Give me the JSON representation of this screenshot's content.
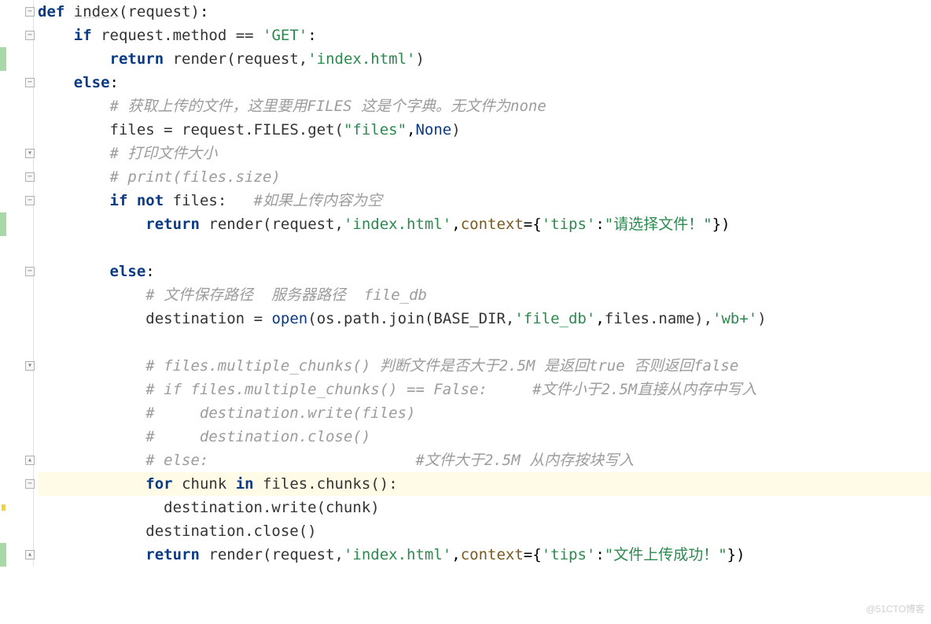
{
  "watermark": "@51CTO博客",
  "gutter": {
    "fold_minus": "−",
    "fold_open_down": "▾",
    "fold_open_up": "▴"
  },
  "code": {
    "l1": {
      "def": "def",
      "sp": " ",
      "fn": "index",
      "lp": "(",
      "arg": "request",
      "rp": ")",
      "colon": ":"
    },
    "l2": {
      "if": "if",
      "sp": " ",
      "expr": "request.method ",
      "eq": "==",
      "sp2": " ",
      "s": "'GET'",
      "colon": ":"
    },
    "l3": {
      "ret": "return",
      "sp": " ",
      "call": "render(request,",
      "s": "'index.html'",
      "rp": ")"
    },
    "l4": {
      "else": "else",
      "colon": ":"
    },
    "l5": {
      "c": "# 获取上传的文件，这里要用FILES 这是个字典。无文件为none"
    },
    "l6": {
      "a": "files ",
      "eq": "=",
      "b": " request.FILES.get(",
      "s1": "\"files\"",
      "comma": ",",
      "none": "None",
      "rp": ")"
    },
    "l7": {
      "c": "# 打印文件大小"
    },
    "l8": {
      "c": "# print(files.size)"
    },
    "l9": {
      "if": "if",
      "sp": " ",
      "not": "not",
      "sp2": " ",
      "id": "files:",
      "pad": "   ",
      "c": "#如果上传内容为空"
    },
    "l10": {
      "ret": "return",
      "sp": " ",
      "call": "render(request,",
      "s": "'index.html'",
      "comma": ",",
      "kwarg": "context",
      "eq": "=",
      "brace": "{",
      "k": "'tips'",
      "colon": ":",
      "v": "\"请选择文件！\"",
      "rb": "})"
    },
    "l11": {
      "blank": " "
    },
    "l12": {
      "else": "else",
      "colon": ":"
    },
    "l13": {
      "c": "# 文件保存路径  服务器路径  file_db"
    },
    "l14": {
      "a": "destination ",
      "eq": "=",
      "sp": " ",
      "open": "open",
      "lp": "(",
      "b": "os.path.join(BASE_DIR,",
      "s1": "'file_db'",
      "comma": ",",
      "c2": "files.name),",
      "s2": "'wb+'",
      "rp": ")"
    },
    "l15": {
      "blank": " "
    },
    "l16": {
      "c": "# files.multiple_chunks() 判断文件是否大于2.5M 是返回true 否则返回false"
    },
    "l17": {
      "c": "# if files.multiple_chunks() == False:     #文件小于2.5M直接从内存中写入"
    },
    "l18": {
      "c": "#     destination.write(files)"
    },
    "l19": {
      "c": "#     destination.close()"
    },
    "l20": {
      "c": "# else:                       #文件大于2.5M 从内存按块写入"
    },
    "l21": {
      "for": "for",
      "sp": " ",
      "v": "chunk ",
      "in": "in",
      "sp2": " ",
      "call": "files.chunks():"
    },
    "l22": {
      "call": "destination.write(chunk)"
    },
    "l23": {
      "call": "destination.close()"
    },
    "l24": {
      "ret": "return",
      "sp": " ",
      "call": "render(request,",
      "s": "'index.html'",
      "comma": ",",
      "kwarg": "context",
      "eq": "=",
      "brace": "{",
      "k": "'tips'",
      "colon": ":",
      "v": "\"文件上传成功！\"",
      "rb": "})"
    }
  }
}
